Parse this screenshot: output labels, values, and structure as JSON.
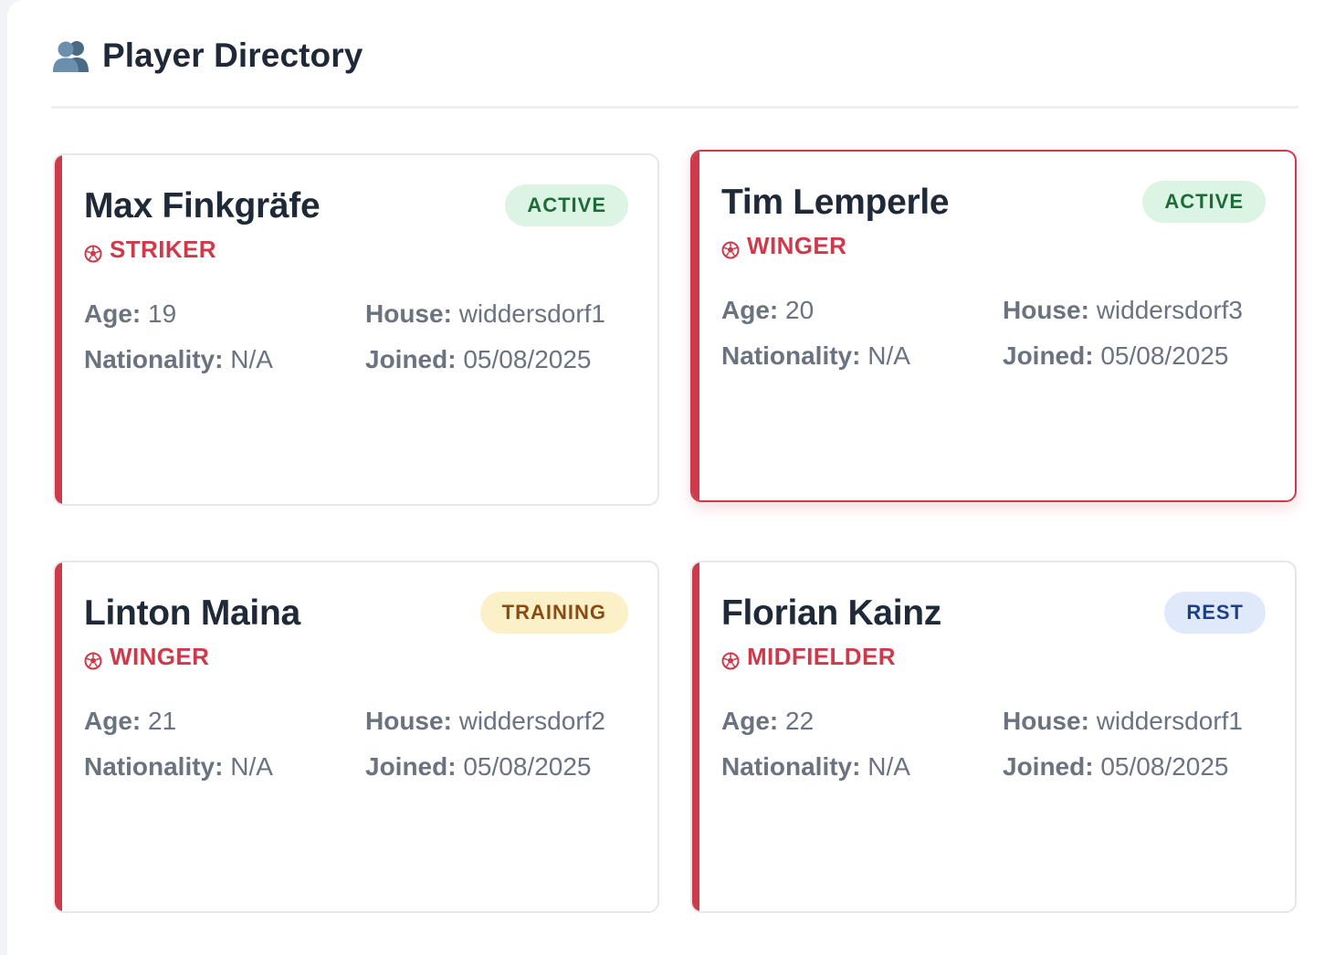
{
  "header": {
    "icon": "people-icon",
    "title": "Player Directory"
  },
  "labels": {
    "age": "Age:",
    "nationality": "Nationality:",
    "house": "House:",
    "joined": "Joined:"
  },
  "colors": {
    "accent": "#cf3a4b",
    "active_badge_bg": "#dcf4e4",
    "training_badge_bg": "#fcf0c9",
    "rest_badge_bg": "#dfe9f9"
  },
  "players": [
    {
      "name": "Max Finkgräfe",
      "status": "ACTIVE",
      "position": "STRIKER",
      "age": "19",
      "nationality": "N/A",
      "house": "widdersdorf1",
      "joined": "05/08/2025"
    },
    {
      "name": "Tim Lemperle",
      "status": "ACTIVE",
      "position": "WINGER",
      "age": "20",
      "nationality": "N/A",
      "house": "widdersdorf3",
      "joined": "05/08/2025",
      "selected": true
    },
    {
      "name": "Linton Maina",
      "status": "TRAINING",
      "position": "WINGER",
      "age": "21",
      "nationality": "N/A",
      "house": "widdersdorf2",
      "joined": "05/08/2025"
    },
    {
      "name": "Florian Kainz",
      "status": "REST",
      "position": "MIDFIELDER",
      "age": "22",
      "nationality": "N/A",
      "house": "widdersdorf1",
      "joined": "05/08/2025"
    }
  ]
}
